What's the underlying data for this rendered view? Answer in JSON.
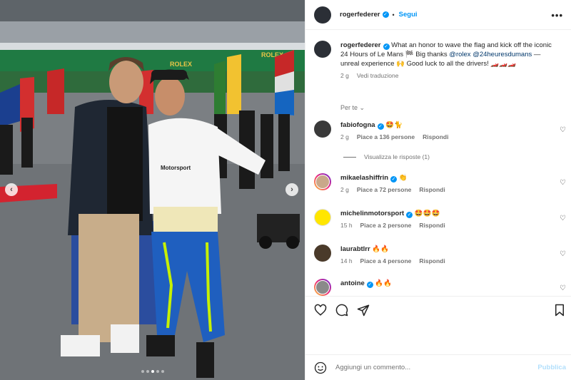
{
  "post": {
    "username": "rogerfederer",
    "follow_label": "Segui",
    "bullet": "•",
    "more": "•••",
    "caption": "What an honor to wave the flag and kick off the iconic 24 Hours of Le Mans 🏁 Big thanks",
    "mention_rolex": "@rolex",
    "mention_lemans": "@24heuresdumans",
    "caption_end": "— unreal experience 🙌 Good luck to all the drivers! 🏎️🏎️🏎️",
    "time": "2 g",
    "translate_label": "Vedi traduzione",
    "sort_label": "Per te"
  },
  "comments": [
    {
      "user": "fabiofogna",
      "verified": true,
      "text": "🤩🐈",
      "time": "2 g",
      "likes": "Piace a 136 persone",
      "reply": "Rispondi",
      "avatar_color": "#3a3a3a"
    },
    {
      "user": "mikaelashiffrin",
      "verified": true,
      "text": "👏",
      "time": "2 g",
      "likes": "Piace a 72 persone",
      "reply": "Rispondi",
      "avatar_color": "#c9a88a"
    },
    {
      "user": "michelinmotorsport",
      "verified": true,
      "text": "🤩🤩🤩",
      "time": "15 h",
      "likes": "Piace a 2 persone",
      "reply": "Rispondi",
      "avatar_color": "#ffe600"
    },
    {
      "user": "laurabtlrr",
      "verified": false,
      "text": "🔥🔥",
      "time": "14 h",
      "likes": "Piace a 4 persone",
      "reply": "Rispondi",
      "avatar_color": "#4a3a2a"
    },
    {
      "user": "antoine",
      "verified": true,
      "text": "🔥🔥",
      "time": "",
      "likes": "",
      "reply": "",
      "avatar_color": "#8a8a8a"
    }
  ],
  "replies_label": "Visualizza le risposte (1)",
  "photo_text": {
    "rolex_1": "ROLEX",
    "rolex_2": "ROLEX",
    "motorsport": "Motorsport"
  },
  "carousel": {
    "count": 5,
    "active": 2
  },
  "icons": {
    "like": "heart-icon",
    "comment": "comment-icon",
    "share": "share-icon",
    "save": "bookmark-icon",
    "emoji": "emoji-icon",
    "prev": "chevron-left-icon",
    "next": "chevron-right-icon"
  },
  "comment_box": {
    "placeholder": "Aggiungi un commento...",
    "publish_label": "Pubblica"
  },
  "colors": {
    "accent": "#0095f6",
    "muted": "#737373",
    "publish_disabled": "#b2dffc"
  }
}
